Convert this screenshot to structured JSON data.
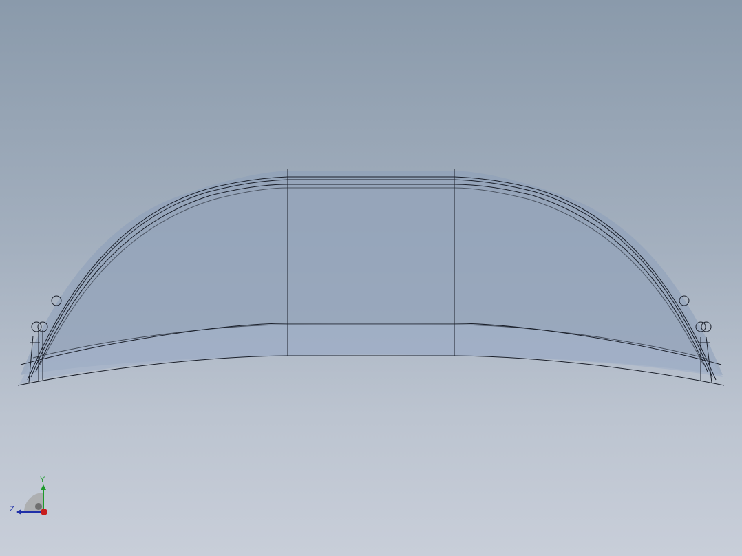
{
  "viewport": {
    "background_top": "#8a9aab",
    "background_bottom": "#c8ced9"
  },
  "model": {
    "fill_color": "#9ba9bd",
    "edge_color": "#1a1f2a"
  },
  "triad": {
    "y_label": "Y",
    "z_label": "Z",
    "y_color": "#1c9a2a",
    "z_color": "#1f2fa8",
    "x_color": "#c81d1d"
  }
}
